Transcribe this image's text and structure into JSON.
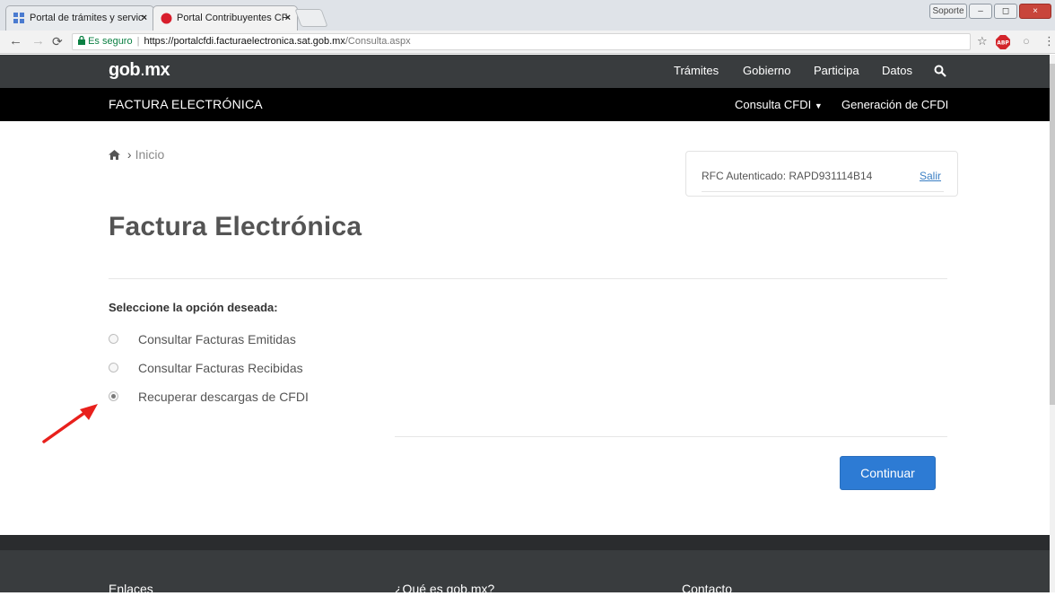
{
  "browser": {
    "tabs": [
      {
        "label": "Portal de trámites y servic",
        "close": "×"
      },
      {
        "label": "Portal Contribuyentes CF",
        "close": "×"
      }
    ],
    "window_buttons": [
      "Soporte",
      "–",
      "◻",
      "×"
    ],
    "secure_label": "Es seguro",
    "url_main": "https://portalcfdi.facturaelectronica.sat.gob.mx",
    "url_path": "/Consulta.aspx"
  },
  "header": {
    "logo": "gob",
    "logo_suffix": "mx",
    "nav": [
      "Trámites",
      "Gobierno",
      "Participa",
      "Datos"
    ],
    "brand": "FACTURA ELECTRÓNICA",
    "menu_consulta": "Consulta CFDI",
    "menu_generacion": "Generación de CFDI"
  },
  "breadcrumb": {
    "home": "Inicio"
  },
  "auth": {
    "rfc": "RFC Autenticado: RAPD931114B14",
    "salir": "Salir"
  },
  "main": {
    "title": "Factura Electrónica",
    "prompt": "Seleccione la opción deseada:",
    "options": [
      {
        "label": "Consultar Facturas Emitidas",
        "checked": false
      },
      {
        "label": "Consultar Facturas Recibidas",
        "checked": false
      },
      {
        "label": "Recuperar descargas de CFDI",
        "checked": true
      }
    ],
    "continue": "Continuar"
  },
  "footer": {
    "columns": [
      "Enlaces",
      "¿Qué es gob.mx?",
      "Contacto"
    ]
  },
  "colors": {
    "accent": "#2d7bd4",
    "annotation_arrow": "#e8201c",
    "header": "#393c3e"
  }
}
